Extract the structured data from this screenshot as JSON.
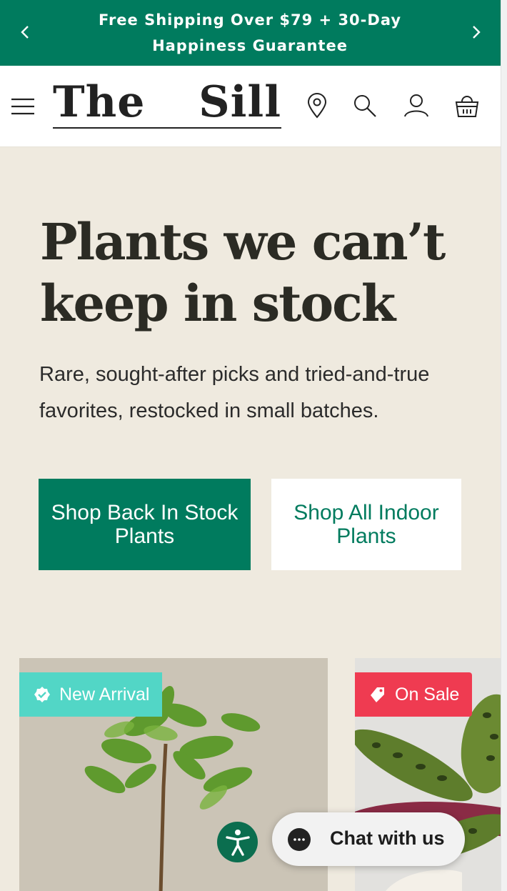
{
  "announcement": {
    "text": "Free Shipping Over $79 + 30-Day Happiness Guarantee",
    "prev_icon": "chevron-left-icon",
    "next_icon": "chevron-right-icon"
  },
  "header": {
    "logo_word1": "The",
    "logo_word2": "Sill",
    "icons": [
      "menu-icon",
      "location-pin-icon",
      "search-icon",
      "account-icon",
      "cart-basket-icon"
    ]
  },
  "hero": {
    "title": "Plants we can’t keep in stock",
    "subtitle": "Rare, sought-after picks and tried-and-true favorites, restocked in small batches.",
    "primary_button": "Shop Back In Stock Plants",
    "secondary_button": "Shop All Indoor Plants"
  },
  "products": [
    {
      "badge": "New Arrival",
      "badge_icon": "verified-badge-icon",
      "badge_color": "#52d6c6"
    },
    {
      "badge": "On Sale",
      "badge_icon": "price-tag-icon",
      "badge_color": "#ef3b51"
    }
  ],
  "accessibility": {
    "icon": "accessibility-icon"
  },
  "chat": {
    "label": "Chat with us",
    "icon": "chat-bubble-icon"
  },
  "colors": {
    "brand_green": "#007b5e",
    "background": "#efeadf"
  }
}
